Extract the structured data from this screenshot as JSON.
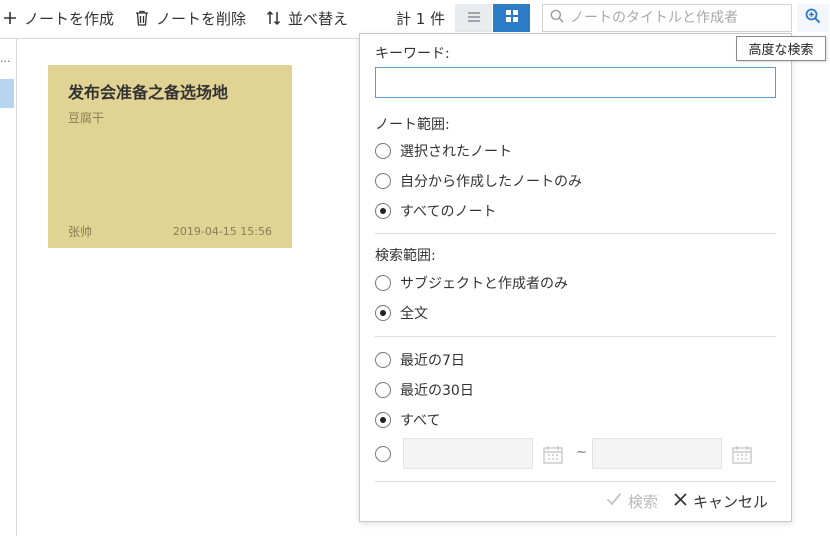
{
  "toolbar": {
    "add_label": "ノートを作成",
    "delete_label": "ノートを削除",
    "sort_label": "並べ替え",
    "count_label": "計 1 件",
    "search_placeholder": "ノートのタイトルと作成者",
    "icons": {
      "add": "plus-icon",
      "delete": "trash-icon",
      "sort": "sort-icon",
      "list_view": "list-icon",
      "grid_view": "grid-icon",
      "search": "search-icon",
      "advanced_search": "zoom-search-icon"
    },
    "accent_color": "#2c7cc6"
  },
  "sidebar": {
    "ellipsis": "..."
  },
  "note": {
    "title": "发布会准备之备选场地",
    "tag": "豆腐干",
    "author": "张帅",
    "date": "2019-04-15 15:56",
    "color": "#e0d394"
  },
  "tooltip": {
    "text": "高度な検索"
  },
  "advanced_search": {
    "keyword_label": "キーワード:",
    "keyword_value": "",
    "note_scope_label": "ノート範囲:",
    "note_scope_options": [
      {
        "label": "選択されたノート",
        "selected": false
      },
      {
        "label": "自分から作成したノートのみ",
        "selected": false
      },
      {
        "label": "すべてのノート",
        "selected": true
      }
    ],
    "search_scope_label": "検索範囲:",
    "search_scope_options": [
      {
        "label": "サブジェクトと作成者のみ",
        "selected": false
      },
      {
        "label": "全文",
        "selected": true
      }
    ],
    "date_options": [
      {
        "label": "最近の7日",
        "selected": false
      },
      {
        "label": "最近の30日",
        "selected": false
      },
      {
        "label": "すべて",
        "selected": true
      }
    ],
    "custom_range": {
      "selected": false,
      "from": "",
      "to": "",
      "separator": "~"
    },
    "search_button": "検索",
    "cancel_button": "キャンセル"
  }
}
